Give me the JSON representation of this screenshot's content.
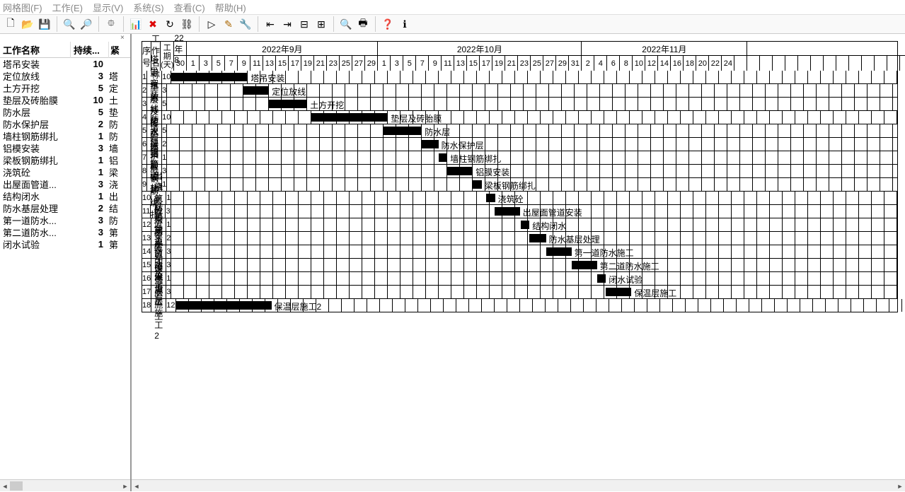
{
  "menubar": {
    "items": [
      {
        "label": "网格图(F)"
      },
      {
        "label": "工作(E)"
      },
      {
        "label": "显示(V)"
      },
      {
        "label": "系统(S)"
      },
      {
        "label": "查看(C)"
      },
      {
        "label": "帮助(H)"
      }
    ]
  },
  "toolbar": {
    "icons": [
      "new",
      "open",
      "save",
      "|",
      "zoom-in",
      "zoom-out",
      "|",
      "tree",
      "|",
      "chart",
      "delete",
      "refresh",
      "link",
      "|",
      "play",
      "tool",
      "wrench",
      "|",
      "gantt-left",
      "gantt-right",
      "gantt-cut",
      "gantt-gap",
      "|",
      "preview",
      "print",
      "|",
      "help",
      "about"
    ]
  },
  "left": {
    "close": "×",
    "headers": {
      "c1": "工作名称",
      "c2": "持续...",
      "c3": "紧"
    },
    "rows": [
      {
        "name": "塔吊安装",
        "dur": "10",
        "succ": ""
      },
      {
        "name": "定位放线",
        "dur": "3",
        "succ": "塔"
      },
      {
        "name": "土方开挖",
        "dur": "5",
        "succ": "定"
      },
      {
        "name": "垫层及砖胎膜",
        "dur": "10",
        "succ": "土"
      },
      {
        "name": "防水层",
        "dur": "5",
        "succ": "垫"
      },
      {
        "name": "防水保护层",
        "dur": "2",
        "succ": "防"
      },
      {
        "name": "墙柱钢筋绑扎",
        "dur": "1",
        "succ": "防"
      },
      {
        "name": "铝模安装",
        "dur": "3",
        "succ": "墙"
      },
      {
        "name": "梁板钢筋绑扎",
        "dur": "1",
        "succ": "铝"
      },
      {
        "name": "浇筑砼",
        "dur": "1",
        "succ": "梁"
      },
      {
        "name": "出屋面管道...",
        "dur": "3",
        "succ": "浇"
      },
      {
        "name": "结构闭水",
        "dur": "1",
        "succ": "出"
      },
      {
        "name": "防水基层处理",
        "dur": "2",
        "succ": "结"
      },
      {
        "name": "第一道防水...",
        "dur": "3",
        "succ": "防"
      },
      {
        "name": "第二道防水...",
        "dur": "3",
        "succ": "第"
      },
      {
        "name": "闭水试验",
        "dur": "1",
        "succ": "第"
      }
    ]
  },
  "gantt": {
    "headers": {
      "seq": "序号",
      "name": "工作名称",
      "dur": "工期(天)"
    },
    "months": [
      {
        "label": "22年8",
        "days": 1
      },
      {
        "label": "2022年9月",
        "days": 15
      },
      {
        "label": "2022年10月",
        "days": 16
      },
      {
        "label": "2022年11月",
        "days": 13
      },
      {
        "label": "",
        "days": 13
      }
    ],
    "days": [
      "30",
      "1",
      "3",
      "5",
      "7",
      "9",
      "11",
      "13",
      "15",
      "17",
      "19",
      "21",
      "23",
      "25",
      "27",
      "29",
      "1",
      "3",
      "5",
      "7",
      "9",
      "11",
      "13",
      "15",
      "17",
      "19",
      "21",
      "23",
      "25",
      "27",
      "29",
      "31",
      "2",
      "4",
      "6",
      "8",
      "10",
      "12",
      "14",
      "16",
      "18",
      "20",
      "22",
      "24",
      "",
      "",
      "",
      "",
      "",
      "",
      "",
      "",
      "",
      "",
      "",
      "",
      "",
      ""
    ],
    "dayCount": 58,
    "rows": [
      {
        "seq": "1",
        "name": "塔吊安装",
        "dur": "10",
        "start": 0,
        "len": 6,
        "label": "塔吊安装"
      },
      {
        "seq": "2",
        "name": "定位放线",
        "dur": "3",
        "start": 6,
        "len": 2,
        "label": "定位放线"
      },
      {
        "seq": "3",
        "name": "土方开挖",
        "dur": "5",
        "start": 8,
        "len": 3,
        "label": "土方开挖"
      },
      {
        "seq": "4",
        "name": "垫层及砖胎膜",
        "dur": "10",
        "start": 11,
        "len": 6,
        "label": "垫层及砖胎膜"
      },
      {
        "seq": "5",
        "name": "防水层",
        "dur": "5",
        "start": 17,
        "len": 3,
        "label": "防水层"
      },
      {
        "seq": "6",
        "name": "防水保护层",
        "dur": "2",
        "start": 20,
        "len": 1.3,
        "label": "防水保护层"
      },
      {
        "seq": "7",
        "name": "墙柱钢筋绑扎",
        "dur": "1",
        "start": 21.3,
        "len": 0.7,
        "label": "墙柱钢筋绑扎"
      },
      {
        "seq": "8",
        "name": "铝膜安装",
        "dur": "3",
        "start": 22,
        "len": 2,
        "label": "铝膜安装"
      },
      {
        "seq": "9",
        "name": "梁板钢筋绑扎",
        "dur": "1",
        "start": 24,
        "len": 0.7,
        "label": "梁板钢筋绑扎"
      },
      {
        "seq": "10",
        "name": "浇筑砼",
        "dur": "1",
        "start": 24.7,
        "len": 0.7,
        "label": "浇筑砼"
      },
      {
        "seq": "11",
        "name": "出屋面管道安装",
        "dur": "3",
        "start": 25.4,
        "len": 2,
        "label": "出屋面管道安装"
      },
      {
        "seq": "12",
        "name": "结构闭水",
        "dur": "1",
        "start": 27.4,
        "len": 0.7,
        "label": "结构闭水"
      },
      {
        "seq": "13",
        "name": "防水基层处理",
        "dur": "2",
        "start": 28.1,
        "len": 1.3,
        "label": "防水基层处理"
      },
      {
        "seq": "14",
        "name": "第一道防水施工",
        "dur": "3",
        "start": 29.4,
        "len": 2,
        "label": "第一道防水施工"
      },
      {
        "seq": "15",
        "name": "第二道防水施工",
        "dur": "3",
        "start": 31.4,
        "len": 2,
        "label": "第二道防水施工"
      },
      {
        "seq": "16",
        "name": "闭水试验",
        "dur": "1",
        "start": 33.4,
        "len": 0.7,
        "label": "闭水试验"
      },
      {
        "seq": "17",
        "name": "保温层施工",
        "dur": "3",
        "start": 34.1,
        "len": 2,
        "label": "保温层施工"
      },
      {
        "seq": "18",
        "name": "保温层施工2",
        "dur": "12",
        "start": 0,
        "len": 7.5,
        "label": "保温层施工2"
      }
    ]
  }
}
